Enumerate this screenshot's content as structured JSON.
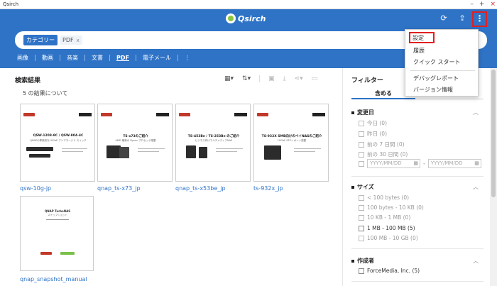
{
  "window": {
    "title": "Qsirch",
    "minimize": "–",
    "maximize": "+",
    "close": "×"
  },
  "header": {
    "logo_text": "Qsirch",
    "search_chips": {
      "category": "カテゴリー",
      "filter": "PDF",
      "remove": "x"
    },
    "tabs": [
      "画像",
      "動画",
      "音楽",
      "文書",
      "PDF",
      "電子メール"
    ],
    "more_tab": "⋮",
    "refresh_icon": "⟳",
    "upload_icon": "⇪",
    "menu_icon": "⋮"
  },
  "menu": {
    "items": [
      "設定",
      "履歴",
      "クイック スタート",
      "デバッグレポート",
      "バージョン情報"
    ]
  },
  "results": {
    "title": "検索結果",
    "count": "5 の結果について",
    "cards": [
      {
        "label": "qsw-10g-jp",
        "title": "QSW-1208-8C / QSW-804-4C",
        "subtitle": "QNAPの革新的な10GbE アンマネージド スイッチ"
      },
      {
        "label": "qnap_ts-x73_jp",
        "title": "TS-x73のご紹介",
        "subtitle": "AMD 最新の Ryzen プロセッサ搭載"
      },
      {
        "label": "qnap_ts-x53be_jp",
        "title": "TS-453Be / TS-253Be のご紹介",
        "subtitle": "ビジネス向けマルチメディアNAS"
      },
      {
        "label": "ts-932x_jp",
        "title": "TS-932X SMB向けのペイNASのご紹介",
        "subtitle": "10GbE SFP+ ポート搭載"
      }
    ],
    "doc": {
      "label": "qnap_snapshot_manual",
      "title": "QNAP TurboNAS",
      "subtitle": "スナップショット"
    }
  },
  "filter": {
    "title": "フィルター",
    "tab": "含める",
    "date_section": {
      "title": "変更日",
      "options": [
        "今日 (0)",
        "昨日 (0)",
        "前の 7 日間 (0)",
        "前の 30 日間 (0)"
      ],
      "from_placeholder": "YYYY/MM/DD",
      "to_placeholder": "YYYY/MM/DD",
      "separator": "-"
    },
    "size_section": {
      "title": "サイズ",
      "options": [
        "< 100 bytes (0)",
        "100 bytes - 10 KB (0)",
        "10 KB - 1 MB (0)",
        "1 MB - 100 MB (5)",
        "100 MB - 10 GB (0)"
      ]
    },
    "author_section": {
      "title": "作成者",
      "options": [
        "ForceMedia, Inc. (5)"
      ]
    }
  }
}
